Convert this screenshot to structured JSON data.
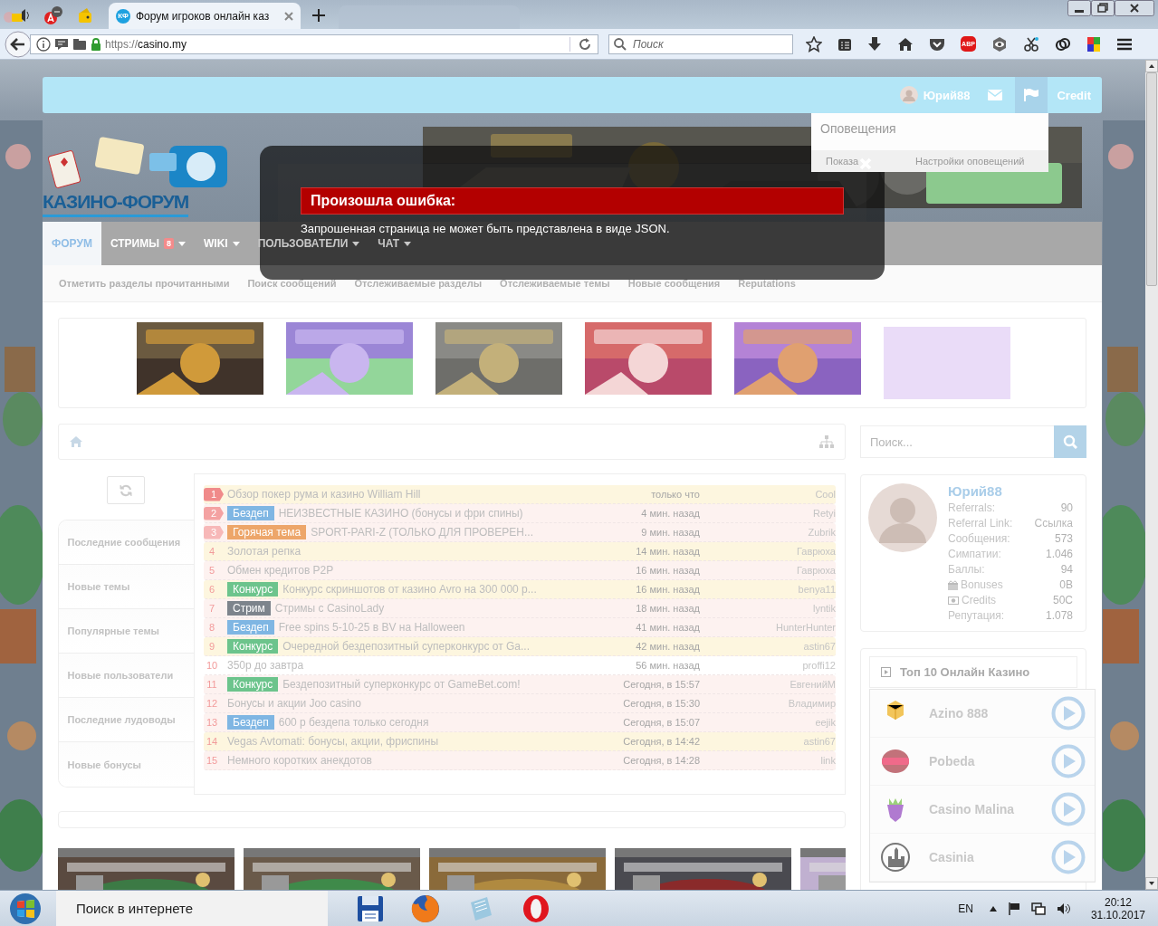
{
  "browser": {
    "tab": {
      "favicon": "КФ",
      "title": "Форум игроков онлайн каз",
      "selected": true
    },
    "url": {
      "scheme": "https://",
      "host": "casino.my"
    },
    "search": {
      "placeholder": "Поиск"
    },
    "adblock_label": "ABP"
  },
  "site": {
    "user_bar": {
      "username": "Юрий88",
      "credit": "Credit",
      "alerts_open": true
    },
    "notifications": {
      "title": "Оповещения",
      "show_all": "Показа",
      "settings": "Настройки оповещений"
    },
    "logo": "КАЗИНО-ФОРУМ",
    "nav": [
      {
        "label": "ФОРУМ",
        "selected": true
      },
      {
        "label": "СТРИМЫ",
        "badge": "8",
        "dropdown": true,
        "selected": false
      },
      {
        "label": "WIKI",
        "dropdown": true,
        "selected": false
      },
      {
        "label": "ПОЛЬЗОВАТЕЛИ",
        "dropdown": true,
        "selected": false
      },
      {
        "label": "ЧАТ",
        "dropdown": true,
        "selected": false
      }
    ],
    "subnav": [
      "Отметить разделы прочитанными",
      "Поиск сообщений",
      "Отслеживаемые разделы",
      "Отслеживаемые темы",
      "Новые сообщения",
      "Reputations"
    ],
    "sidebar_tabs": [
      "Последние сообщения",
      "Новые темы",
      "Популярные темы",
      "Новые пользователи",
      "Последние лудоводы",
      "Новые бонусы"
    ],
    "topics": [
      {
        "number": {
          "text": "1",
          "color": "#f08a8a"
        },
        "title": "Обзор покер рума и казино William Hill",
        "time": "только что",
        "author": "Cool",
        "color": "#fdf6df"
      },
      {
        "number": {
          "text": "2",
          "color": "#f4a2a2"
        },
        "prefix": {
          "text": "Бездеп",
          "color": "#7fb6e3"
        },
        "title": "НЕИЗВЕСТНЫЕ КАЗИНО (бонусы и фри спины)",
        "time": "4 мин. назад",
        "author": "Retyi",
        "color": "#fdf2f0"
      },
      {
        "number": {
          "text": "3",
          "color": "#f7b8b8"
        },
        "prefix": {
          "text": "Горячая тема",
          "color": "#eda66a"
        },
        "title": "SPORT-PARI-Z (ТОЛЬКО ДЛЯ ПРОВЕРЕН...",
        "time": "9 мин. назад",
        "author": "Zubrik",
        "color": "#fdf2f0"
      },
      {
        "number": {
          "text": "4"
        },
        "title": "Золотая репка",
        "time": "14 мин. назад",
        "author": "Гаврюха",
        "color": "#fdf6df"
      },
      {
        "number": {
          "text": "5"
        },
        "title": "Обмен кредитов P2P",
        "time": "16 мин. назад",
        "author": "Гаврюха",
        "color": "#fdf2f0"
      },
      {
        "number": {
          "text": "6"
        },
        "prefix": {
          "text": "Конкурс",
          "color": "#6cc48c"
        },
        "title": "Конкурс скриншотов от казино Avro на 300 000 р...",
        "time": "16 мин. назад",
        "author": "benya11",
        "color": "#fdf6df"
      },
      {
        "number": {
          "text": "7"
        },
        "prefix": {
          "text": "Стрим",
          "color": "#7d848c"
        },
        "title": "Стримы с CasinoLady",
        "time": "18 мин. назад",
        "author": "lyntik",
        "color": "#fdf2f0"
      },
      {
        "number": {
          "text": "8"
        },
        "prefix": {
          "text": "Бездеп",
          "color": "#7fb6e3"
        },
        "title": "Free spins 5-10-25 в BV на Halloween",
        "time": "41 мин. назад",
        "author": "HunterHunter",
        "color": "#fdf2f0"
      },
      {
        "number": {
          "text": "9"
        },
        "prefix": {
          "text": "Конкурс",
          "color": "#6cc48c"
        },
        "title": "Очередной бездепозитный суперконкурс от Ga...",
        "time": "42 мин. назад",
        "author": "astin67",
        "color": "#fdf6df"
      },
      {
        "number": {
          "text": "10"
        },
        "title": "350р до завтра",
        "time": "56 мин. назад",
        "author": "proffi12",
        "color": "#ffffff"
      },
      {
        "number": {
          "text": "11"
        },
        "prefix": {
          "text": "Конкурс",
          "color": "#6cc48c"
        },
        "title": "Бездепозитный суперконкурс от GameBet.com!",
        "time": "Сегодня, в 15:57",
        "author": "ЕвгенийМ",
        "color": "#fdf2f0"
      },
      {
        "number": {
          "text": "12"
        },
        "title": "Бонусы и акции Joo casino",
        "time": "Сегодня, в 15:30",
        "author": "Владимир",
        "color": "#fdf2f0"
      },
      {
        "number": {
          "text": "13"
        },
        "prefix": {
          "text": "Бездеп",
          "color": "#7fb6e3"
        },
        "title": "600 р бездепа только сегодня",
        "time": "Сегодня, в 15:07",
        "author": "eejik",
        "color": "#fdf2f0"
      },
      {
        "number": {
          "text": "14"
        },
        "title": "Vegas Avtomati: бонусы, акции, фриспины",
        "time": "Сегодня, в 14:42",
        "author": "astin67",
        "color": "#fdf6df"
      },
      {
        "number": {
          "text": "15"
        },
        "title": "Немного коротких анекдотов",
        "time": "Сегодня, в 14:28",
        "author": "link",
        "color": "#fdf2f0"
      }
    ],
    "search": {
      "placeholder": "Поиск..."
    },
    "profile": {
      "name": "Юрий88",
      "stats": [
        {
          "label": "Referrals:",
          "value": "90"
        },
        {
          "label": "Referral Link:",
          "value": "Ссылка",
          "kind": "link"
        },
        {
          "label": "Сообщения:",
          "value": "573"
        },
        {
          "label": "Симпатии:",
          "value": "1.046"
        },
        {
          "label": "Баллы:",
          "value": "94"
        },
        {
          "label": "Bonuses",
          "value": "0B",
          "kind": "gift"
        },
        {
          "label": "Credits",
          "value": "50C",
          "kind": "money"
        },
        {
          "label": "Репутация:",
          "value": "1.078"
        }
      ]
    },
    "top_casinos": {
      "title": "Топ 10 Онлайн Казино",
      "items": [
        {
          "name": "Azino 888",
          "kind": "dice"
        },
        {
          "name": "Pobeda",
          "kind": "badge"
        },
        {
          "name": "Casino Malina",
          "kind": "berry"
        },
        {
          "name": "Casinia",
          "kind": "castle"
        }
      ]
    }
  },
  "error_dialog": {
    "title": "Произошла ошибка:",
    "message": "Запрошенная страница не может быть представлена в виде JSON."
  },
  "taskbar": {
    "search": "Поиск в интернете",
    "language": "EN",
    "time": "20:12",
    "date": "31.10.2017"
  }
}
